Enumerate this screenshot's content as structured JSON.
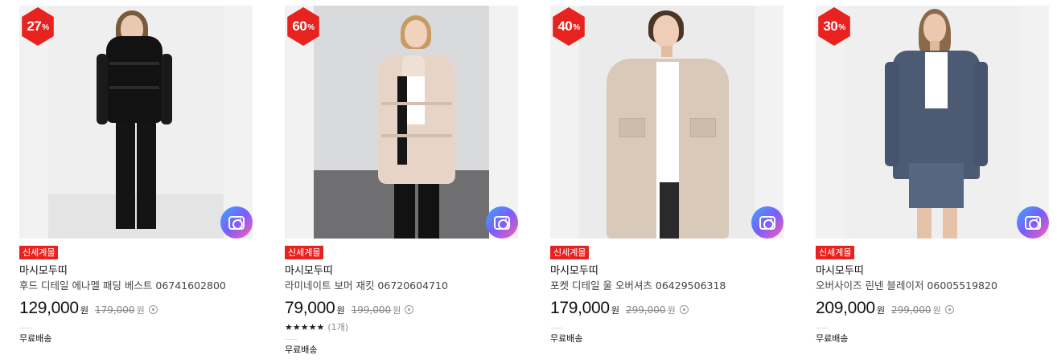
{
  "products": [
    {
      "discount": "27",
      "discount_unit": "%",
      "tag": "신세계몰",
      "brand": "마시모두띠",
      "name": "후드 디테일 에나멜 패딩 베스트 06741602800",
      "price": "129,000",
      "price_unit": "원",
      "original_price": "179,000",
      "original_unit": "원",
      "shipping": "무료배송"
    },
    {
      "discount": "60",
      "discount_unit": "%",
      "tag": "신세계몰",
      "brand": "마시모두띠",
      "name": "라미네이트 보머 재킷 06720604710",
      "price": "79,000",
      "price_unit": "원",
      "original_price": "199,000",
      "original_unit": "원",
      "rating_stars": "★★★★★",
      "rating_count": "(1개)",
      "shipping": "무료배송"
    },
    {
      "discount": "40",
      "discount_unit": "%",
      "tag": "신세계몰",
      "brand": "마시모두띠",
      "name": "포켓 디테일 울 오버셔츠 06429506318",
      "price": "179,000",
      "price_unit": "원",
      "original_price": "299,000",
      "original_unit": "원",
      "shipping": "무료배송"
    },
    {
      "discount": "30",
      "discount_unit": "%",
      "tag": "신세계몰",
      "brand": "마시모두띠",
      "name": "오버사이즈 린넨 블레이저 06005519820",
      "price": "209,000",
      "price_unit": "원",
      "original_price": "299,000",
      "original_unit": "원",
      "shipping": "무료배송"
    }
  ],
  "colors": {
    "accent_red": "#e7221f",
    "camera_gradient": [
      "#3aa7ff",
      "#7b5cff",
      "#ff5fa8"
    ]
  },
  "icons": {
    "camera": "camera-search-icon",
    "info": "info-circle-icon",
    "star": "star-icon"
  }
}
